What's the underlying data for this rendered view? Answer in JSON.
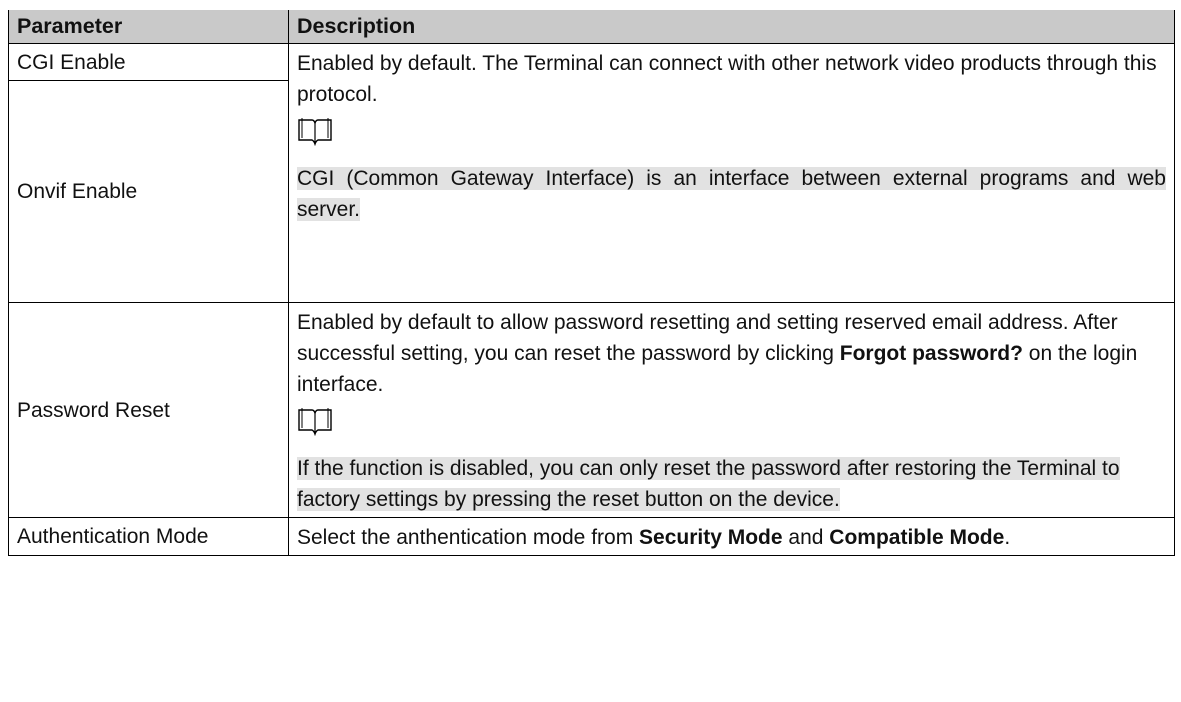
{
  "table": {
    "header": {
      "parameter": "Parameter",
      "description": "Description"
    },
    "rows": {
      "cgi": {
        "name": "CGI Enable"
      },
      "onvif": {
        "name": "Onvif Enable"
      },
      "cgi_onvif_desc": {
        "text": "Enabled by default. The Terminal can connect with other network video products through this protocol.",
        "note": "CGI (Common Gateway Interface) is an interface between external programs and web server."
      },
      "password": {
        "name": "Password Reset",
        "text_before": "Enabled by default to allow password resetting and setting reserved email address. After successful setting, you can reset the password by clicking ",
        "bold": "Forgot password?",
        "text_after": " on the login interface.",
        "note": "If the function is disabled, you can only reset the password after restoring the Terminal to factory settings by pressing the reset button on the device."
      },
      "auth": {
        "name": "Authentication Mode",
        "text_before": "Select the anthentication mode from ",
        "bold1": "Security Mode",
        "text_mid": " and ",
        "bold2": "Compatible Mode",
        "text_after": "."
      }
    },
    "note_icon": "open-book-note-icon"
  }
}
